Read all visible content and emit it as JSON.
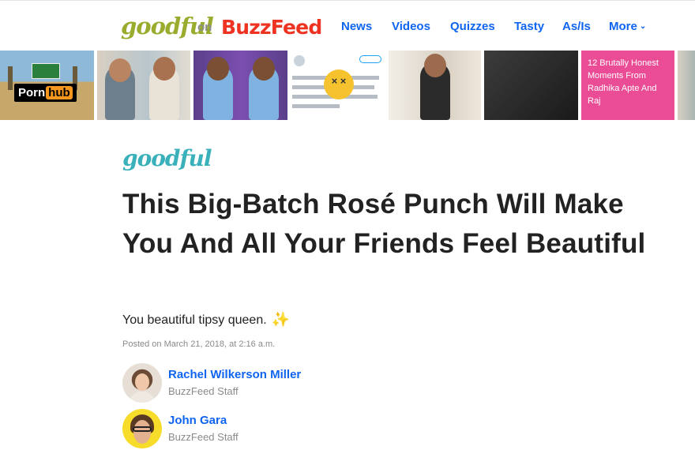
{
  "header": {
    "goodful_logo": "goodful",
    "on_label": "on",
    "buzzfeed_logo": "BuzzFeed",
    "nav": {
      "news": "News",
      "videos": "Videos",
      "quizzes": "Quizzes",
      "tasty": "Tasty",
      "asis": "As/Is",
      "more": "More"
    },
    "more_icon": "chevron-down-icon"
  },
  "strip": {
    "pornhub_badge": {
      "porn": "Porn",
      "hub": "hub"
    },
    "tweet_icon": "dizzy-face-icon",
    "promo_text": "12 Brutally Honest Moments From Radhika Apte And Raj"
  },
  "article": {
    "brand_mark": "goodful",
    "headline": "This Big-Batch Rosé Punch Will Make You And All Your Friends Feel Beautiful",
    "dek": "You beautiful tipsy queen.",
    "dek_icon": "sparkles-icon",
    "posted": "Posted on March 21, 2018, at 2:16 a.m.",
    "authors": [
      {
        "name": "Rachel Wilkerson Miller",
        "role": "BuzzFeed Staff"
      },
      {
        "name": "John Gara",
        "role": "BuzzFeed Staff"
      }
    ]
  },
  "colors": {
    "link_blue": "#0f65ef",
    "buzzfeed_red": "#ee3322",
    "goodful_green": "#9aab2e",
    "goodful_teal": "#39b0ba",
    "promo_pink": "#ea4d96"
  }
}
